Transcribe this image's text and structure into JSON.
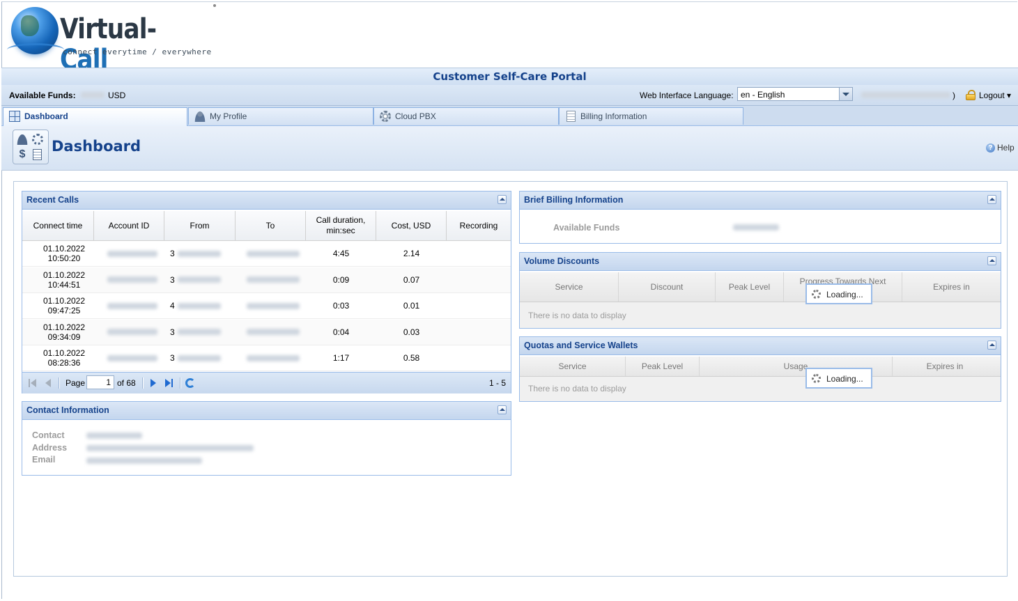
{
  "brand": {
    "name_left": "Virtual-",
    "name_right": "Call",
    "tagline": "connect everytime / everywhere"
  },
  "portal_title": "Customer Self-Care Portal",
  "topbar": {
    "funds_label": "Available Funds:",
    "funds_currency": "USD",
    "language_label": "Web Interface Language:",
    "language_value": "en - English",
    "user_suffix": ")",
    "logout_label": "Logout ▾"
  },
  "tabs": [
    {
      "label": "Dashboard",
      "active": true
    },
    {
      "label": "My Profile"
    },
    {
      "label": "Cloud PBX"
    },
    {
      "label": "Billing Information"
    }
  ],
  "page": {
    "title": "Dashboard",
    "help_label": "Help"
  },
  "recent_calls": {
    "title": "Recent Calls",
    "columns": [
      "Connect time",
      "Account ID",
      "From",
      "To",
      "Call duration, min:sec",
      "Cost, USD",
      "Recording"
    ],
    "rows": [
      {
        "time": "01.10.2022\n10:50:20",
        "from_prefix": "3",
        "duration": "4:45",
        "cost": "2.14"
      },
      {
        "time": "01.10.2022\n10:44:51",
        "from_prefix": "3",
        "duration": "0:09",
        "cost": "0.07"
      },
      {
        "time": "01.10.2022\n09:47:25",
        "from_prefix": "4",
        "duration": "0:03",
        "cost": "0.01"
      },
      {
        "time": "01.10.2022\n09:34:09",
        "from_prefix": "3",
        "duration": "0:04",
        "cost": "0.03"
      },
      {
        "time": "01.10.2022\n08:28:36",
        "from_prefix": "3",
        "duration": "1:17",
        "cost": "0.58"
      }
    ],
    "pager": {
      "page_label": "Page",
      "page_value": "1",
      "of_label": "of 68",
      "range": "1 - 5"
    }
  },
  "contact": {
    "title": "Contact Information",
    "labels": [
      "Contact",
      "Address",
      "Email"
    ]
  },
  "billing": {
    "title": "Brief Billing Information",
    "funds_label": "Available Funds"
  },
  "volume_discounts": {
    "title": "Volume Discounts",
    "columns": [
      "Service",
      "Discount",
      "Peak Level",
      "Progress Towards Next",
      "Expires in"
    ],
    "empty_text": "There is no data to display",
    "loading_text": "Loading..."
  },
  "quotas": {
    "title": "Quotas and Service Wallets",
    "columns": [
      "Service",
      "Peak Level",
      "Usage",
      "Expires in"
    ],
    "empty_text": "There is no data to display",
    "loading_text": "Loading..."
  }
}
